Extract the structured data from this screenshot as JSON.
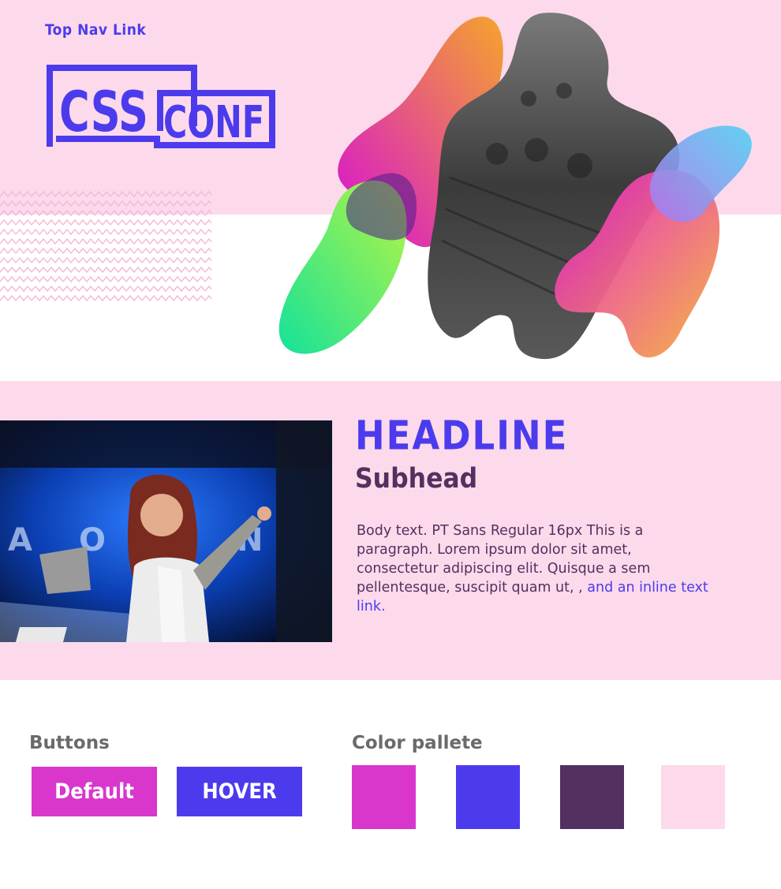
{
  "nav": {
    "top_nav_link": "Top Nav Link"
  },
  "logo": {
    "part1": "CSS",
    "part2": "CONF"
  },
  "feature": {
    "headline": "HEADLINE",
    "subhead": "Subhead",
    "body": "Body text. PT Sans Regular 16px This is a paragraph. Lorem ipsum dolor sit amet, consectetur adipiscing elit. Quisque a sem pellentesque, suscipit quam ut, , ",
    "inline_link": "and an inline text link."
  },
  "buttons": {
    "label": "Buttons",
    "default_label": "Default",
    "hover_label": "HOVER"
  },
  "palette": {
    "label": "Color pallete",
    "colors": [
      "#d936cc",
      "#4c3bed",
      "#53305f",
      "#fcdaeb"
    ]
  },
  "theme": {
    "primary": "#4c3bed",
    "magenta": "#d936cc",
    "plum": "#53305f",
    "pink": "#fcdaeb"
  }
}
